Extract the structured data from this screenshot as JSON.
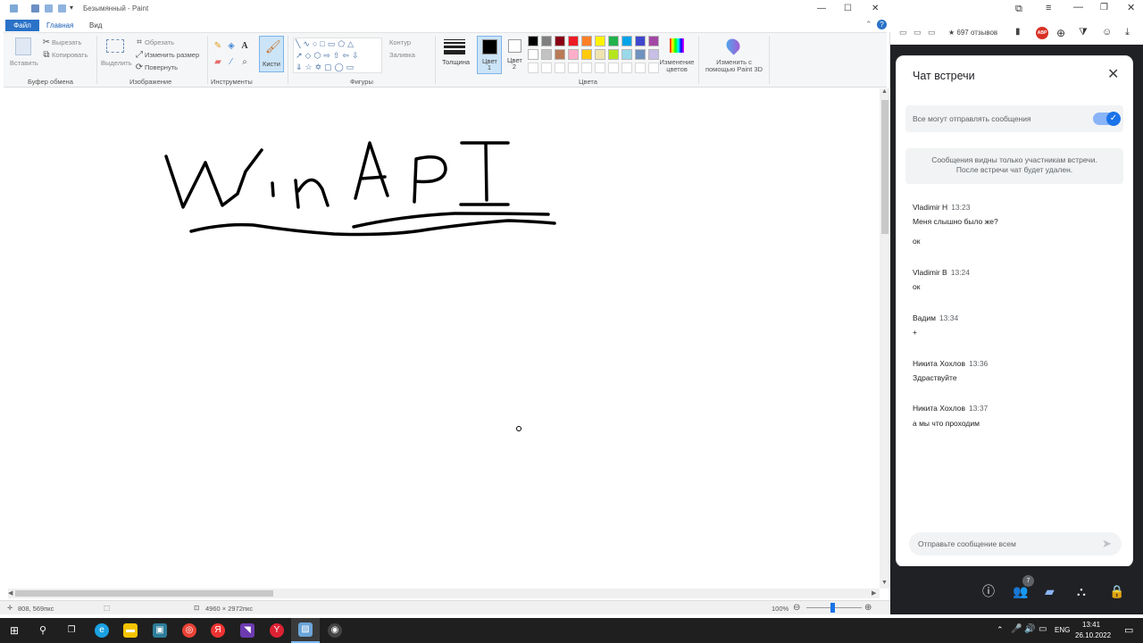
{
  "paint": {
    "window_title": "Безымянный - Paint",
    "tabs": {
      "file": "Файл",
      "home": "Главная",
      "view": "Вид"
    },
    "ribbon": {
      "clipboard": {
        "paste": "Вставить",
        "cut": "Вырезать",
        "copy": "Копировать",
        "group": "Буфер обмена"
      },
      "image": {
        "select": "Выделить",
        "crop": "Обрезать",
        "resize": "Изменить размер",
        "rotate": "Повернуть",
        "group": "Изображение"
      },
      "tools": {
        "group": "Инструменты",
        "brushes": "Кисти"
      },
      "shapes": {
        "outline": "Контур",
        "fill": "Заливка",
        "group": "Фигуры"
      },
      "size": {
        "label": "Толщина"
      },
      "color1": {
        "label": "Цвет",
        "num": "1"
      },
      "color2": {
        "label": "Цвет",
        "num": "2"
      },
      "colors": {
        "group": "Цвета",
        "edit": "Изменение цветов",
        "paint3d": "Изменить с помощью Paint 3D"
      }
    },
    "palette": [
      "#000000",
      "#7f7f7f",
      "#880015",
      "#ed1c24",
      "#ff7f27",
      "#fff200",
      "#22b14c",
      "#00a2e8",
      "#3f48cc",
      "#a349a4",
      "#ffffff",
      "#c3c3c3",
      "#b97a57",
      "#ffaec9",
      "#ffc90e",
      "#efe4b0",
      "#b5e61d",
      "#99d9ea",
      "#7092be",
      "#c8bfe7"
    ],
    "status": {
      "cursor_pos": "808, 569пкс",
      "image_size": "4960 × 2972пкс",
      "zoom": "100%"
    }
  },
  "browser_toolbar": {
    "ext_count": "★ 697 отзывов"
  },
  "chat": {
    "title": "Чат встречи",
    "permission_label": "Все могут отправлять сообщения",
    "info_line1": "Сообщения видны только участникам встречи.",
    "info_line2": "После встречи чат будет удален.",
    "messages": [
      {
        "author": "Vladimir H",
        "time": "13:23",
        "lines": [
          "Меня слышно было же?",
          "ок"
        ]
      },
      {
        "author": "Vladimir B",
        "time": "13:24",
        "lines": [
          "ок"
        ]
      },
      {
        "author": "Вадим",
        "time": "13:34",
        "lines": [
          "+"
        ]
      },
      {
        "author": "Никита Хохлов",
        "time": "13:36",
        "lines": [
          "Здраствуйте"
        ]
      },
      {
        "author": "Никита Хохлов",
        "time": "13:37",
        "lines": [
          "а мы что проходим"
        ]
      }
    ],
    "input_placeholder": "Отправьте сообщение всем",
    "participants_badge": "7"
  },
  "taskbar": {
    "lang": "ENG",
    "time": "13:41",
    "date": "26.10.2022"
  }
}
